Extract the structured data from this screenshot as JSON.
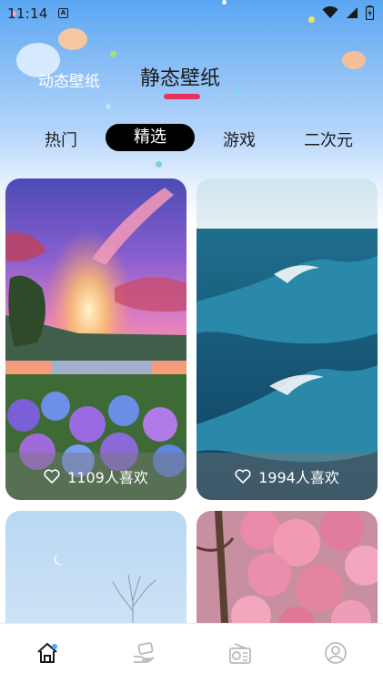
{
  "status_bar": {
    "time": "11:14",
    "app_icon": "A"
  },
  "header": {
    "tabs": [
      {
        "label": "动态壁纸",
        "active": false
      },
      {
        "label": "静态壁纸",
        "active": true
      }
    ],
    "indicator_color": "#e8345c"
  },
  "categories": {
    "items": [
      "热门",
      "精选",
      "游戏",
      "二次元"
    ],
    "selected": "精选"
  },
  "wallpapers": [
    {
      "scene": "sunset-hydrangea",
      "likes": "1109人喜欢",
      "like_icon": "heart-outline-icon"
    },
    {
      "scene": "ocean-waves",
      "likes": "1994人喜欢",
      "like_icon": "heart-outline-icon"
    },
    {
      "scene": "winter-tree-sky"
    },
    {
      "scene": "pink-blossoms"
    }
  ],
  "bottom_nav": {
    "items": [
      {
        "icon": "home-icon",
        "active": true
      },
      {
        "icon": "hand-card-icon",
        "active": false
      },
      {
        "icon": "radio-icon",
        "active": false
      },
      {
        "icon": "profile-icon",
        "active": false
      }
    ]
  },
  "colors": {
    "accent": "#e8345c",
    "selected_chip": "#000000",
    "nav_active_dot": "#4aa3ff"
  }
}
